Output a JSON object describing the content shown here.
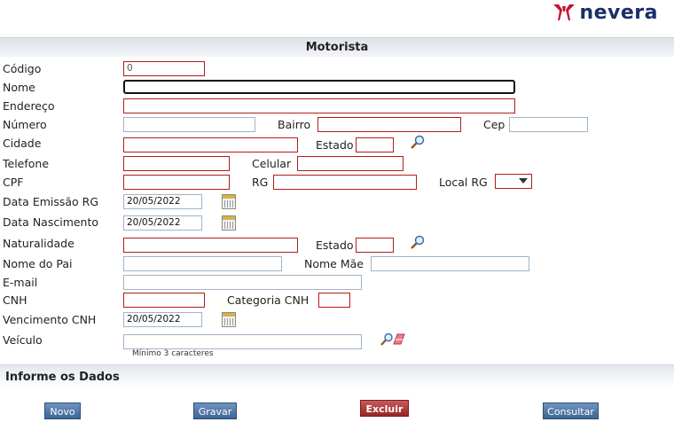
{
  "brand": {
    "name": "nevera"
  },
  "form": {
    "title": "Motorista",
    "codigo": {
      "label": "Código",
      "value": "0"
    },
    "nome": {
      "label": "Nome",
      "value": ""
    },
    "endereco": {
      "label": "Endereço",
      "value": ""
    },
    "numero": {
      "label": "Número",
      "value": ""
    },
    "bairro": {
      "label": "Bairro",
      "value": ""
    },
    "cep": {
      "label": "Cep",
      "value": ""
    },
    "cidade": {
      "label": "Cidade",
      "value": ""
    },
    "estado": {
      "label": "Estado",
      "value": ""
    },
    "telefone": {
      "label": "Telefone",
      "value": ""
    },
    "celular": {
      "label": "Celular",
      "value": ""
    },
    "cpf": {
      "label": "CPF",
      "value": ""
    },
    "rg": {
      "label": "RG",
      "value": ""
    },
    "local_rg": {
      "label": "Local RG",
      "value": ""
    },
    "data_emissao_rg": {
      "label": "Data Emissão RG",
      "value": "20/05/2022"
    },
    "data_nascimento": {
      "label": "Data Nascimento",
      "value": "20/05/2022"
    },
    "naturalidade": {
      "label": "Naturalidade",
      "value": ""
    },
    "estado_naturalidade": {
      "label": "Estado",
      "value": ""
    },
    "nome_pai": {
      "label": "Nome do Pai",
      "value": ""
    },
    "nome_mae": {
      "label": "Nome Mãe",
      "value": ""
    },
    "email": {
      "label": "E-mail",
      "value": ""
    },
    "cnh": {
      "label": "CNH",
      "value": ""
    },
    "categoria_cnh": {
      "label": "Categoria CNH",
      "value": ""
    },
    "vencimento_cnh": {
      "label": "Vencimento CNH",
      "value": "20/05/2022"
    },
    "veiculo": {
      "label": "Veículo",
      "value": "",
      "hint": "Mínimo 3 caracteres"
    }
  },
  "footer": {
    "title": "Informe os Dados",
    "buttons": {
      "novo": "Novo",
      "gravar": "Gravar",
      "excluir": "Excluir",
      "consultar": "Consultar"
    }
  },
  "colors": {
    "required_border": "#b51a1a",
    "optional_border": "#a0b4c8",
    "brand": "#1b2f6b",
    "brand_mark": "#c8102e"
  },
  "icons": [
    "search-icon",
    "calendar-icon",
    "eraser-icon"
  ]
}
